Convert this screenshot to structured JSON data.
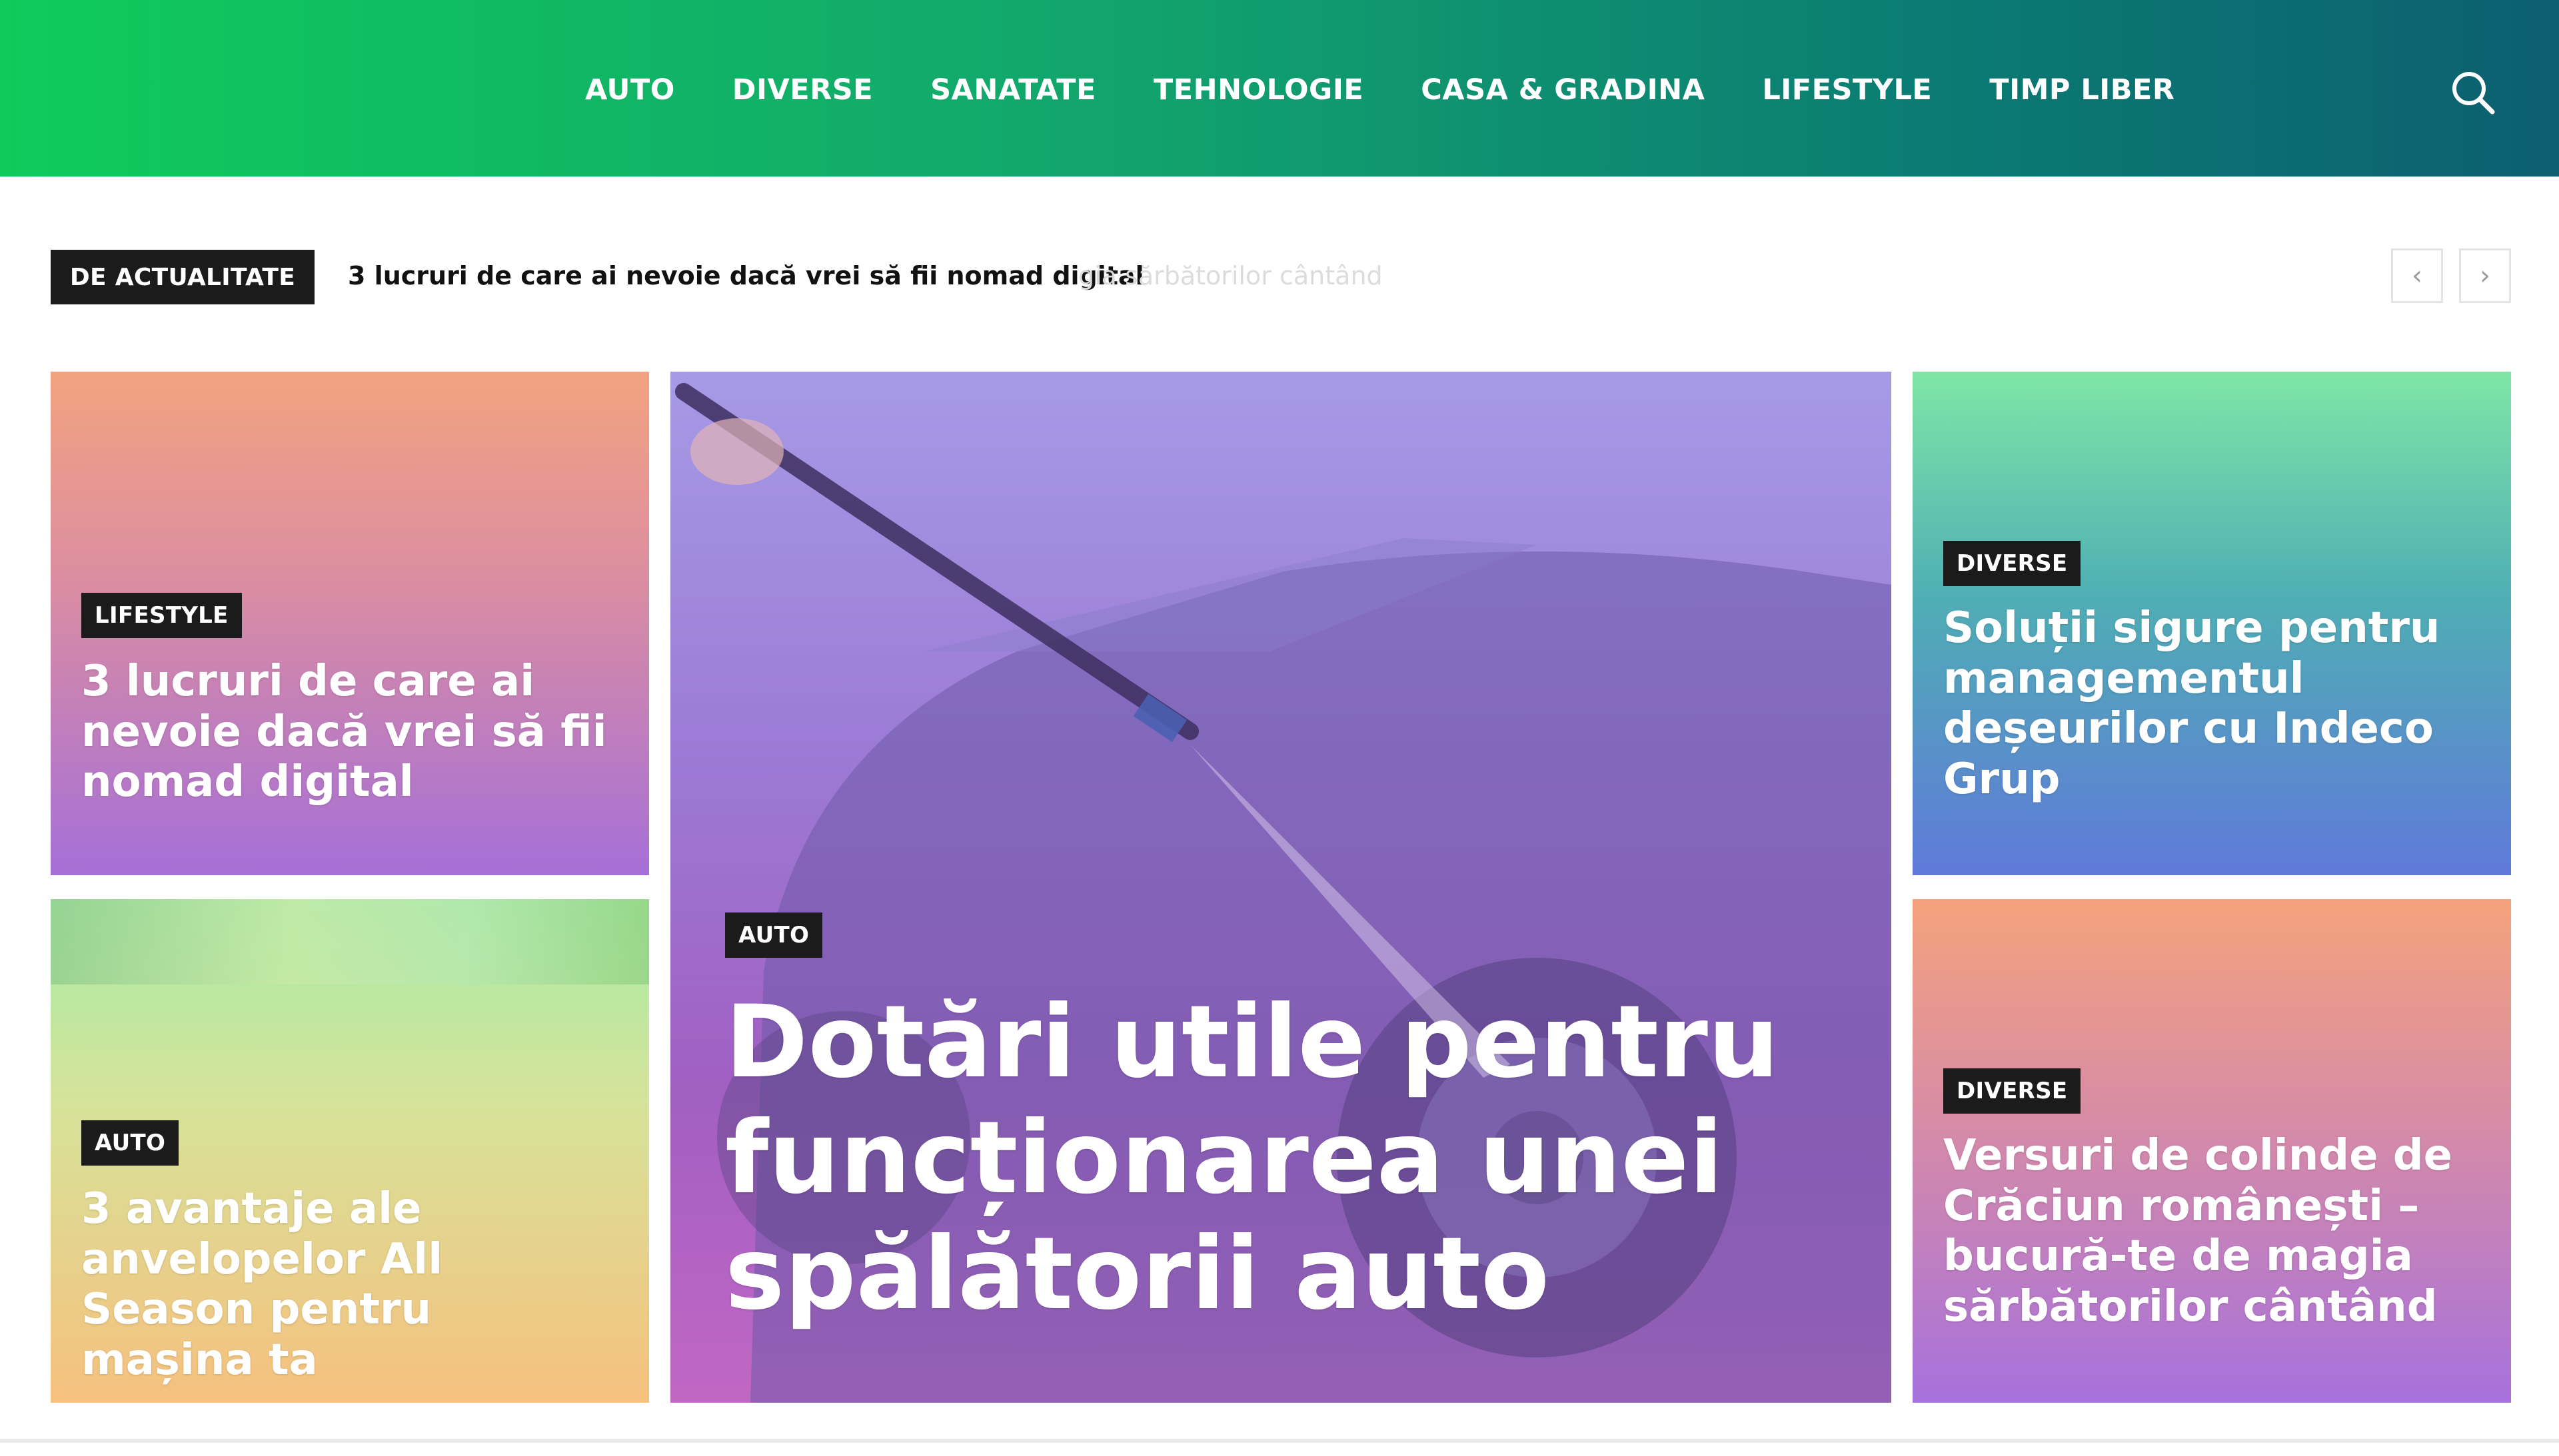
{
  "nav": {
    "items": [
      "AUTO",
      "DIVERSE",
      "SANATATE",
      "TEHNOLOGIE",
      "CASA & GRADINA",
      "LIFESTYLE",
      "TIMP LIBER"
    ],
    "search_icon": "search-icon"
  },
  "ticker": {
    "label": "DE ACTUALITATE",
    "headline": "3 lucruri de care ai nevoie dacă vrei să fii nomad digital",
    "ghost": "gia sărbătorilor cântând",
    "prev_icon": "chevron-left-icon",
    "next_icon": "chevron-right-icon"
  },
  "cards": {
    "top_left": {
      "category": "LIFESTYLE",
      "title": "3 lucruri de care ai nevoie dacă vrei să fii nomad digital"
    },
    "bottom_left": {
      "category": "AUTO",
      "title": "3 avantaje ale anvelopelor All Season pentru mașina ta"
    },
    "center": {
      "category": "AUTO",
      "title": "Dotări utile pentru funcționarea unei spălătorii auto"
    },
    "top_right": {
      "category": "DIVERSE",
      "title": "Soluții sigure pentru managementul deșeurilor cu Indeco Grup"
    },
    "bottom_right": {
      "category": "DIVERSE",
      "title": "Versuri de colinde de Crăciun românești – bucură-te de magia sărbătorilor cântând"
    }
  },
  "colors": {
    "header_start": "#0fcb5b",
    "header_end": "#0c5f70",
    "badge_bg": "#1b1b1b"
  }
}
